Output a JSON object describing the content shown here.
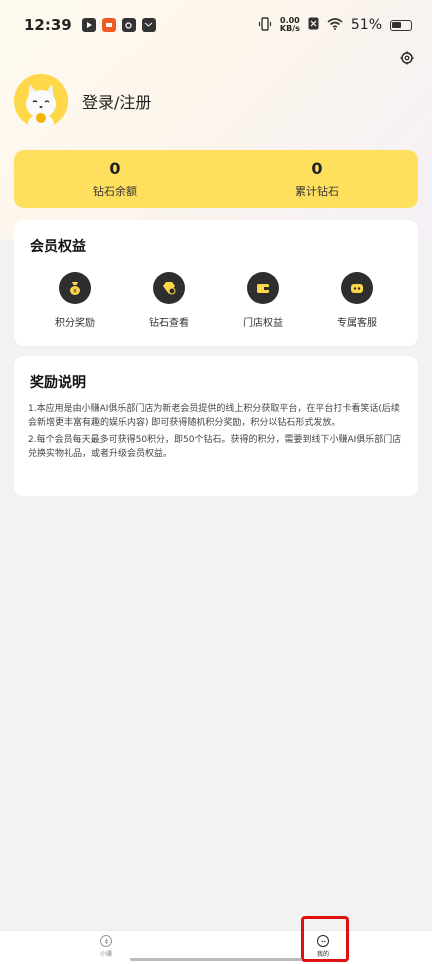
{
  "status_bar": {
    "time": "12:39",
    "net_speed_value": "0.00",
    "net_speed_unit": "KB/s",
    "battery_percent": "51%"
  },
  "profile": {
    "login_label": "登录/注册"
  },
  "diamonds": {
    "balance_value": "0",
    "balance_label": "钻石余额",
    "total_value": "0",
    "total_label": "累计钻石"
  },
  "benefits": {
    "title": "会员权益",
    "items": [
      {
        "label": "积分奖励",
        "icon": "money-bag-icon"
      },
      {
        "label": "钻石查看",
        "icon": "diamond-icon"
      },
      {
        "label": "门店权益",
        "icon": "wallet-icon"
      },
      {
        "label": "专属客服",
        "icon": "robot-icon"
      }
    ]
  },
  "reward": {
    "title": "奖励说明",
    "paragraphs": [
      "1.本应用是由小赚AI俱乐部门店为新老会员提供的线上积分获取平台，在平台打卡看笑话(后续会新增更丰富有趣的娱乐内容) 即可获得随机积分奖励，积分以钻石形式发放。",
      "2.每个会员每天最多可获得50积分，即50个钻石。获得的积分，需要到线下小赚AI俱乐部门店兑换实物礼品，或者升级会员权益。"
    ]
  },
  "bottom_nav": {
    "items": [
      {
        "label": "小赚"
      },
      {
        "label": "我的"
      }
    ]
  },
  "colors": {
    "accent_yellow": "#ffdf5e",
    "icon_dark": "#2e2e2e",
    "highlight_red": "#e01010"
  }
}
